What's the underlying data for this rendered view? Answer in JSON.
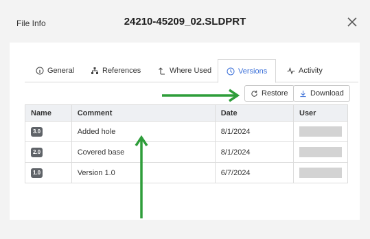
{
  "header": {
    "label": "File Info",
    "title": "24210-45209_02.SLDPRT"
  },
  "tabs": [
    {
      "label": "General",
      "icon": "info-icon"
    },
    {
      "label": "References",
      "icon": "hierarchy-icon"
    },
    {
      "label": "Where Used",
      "icon": "arrow-up-corner-icon"
    },
    {
      "label": "Versions",
      "icon": "clock-icon",
      "active": true
    },
    {
      "label": "Activity",
      "icon": "pulse-icon"
    }
  ],
  "actions": {
    "restore_label": "Restore",
    "download_label": "Download"
  },
  "table": {
    "headers": [
      "Name",
      "Comment",
      "Date",
      "User"
    ],
    "rows": [
      {
        "name": "3.0",
        "comment": "Added hole",
        "date": "8/1/2024"
      },
      {
        "name": "2.0",
        "comment": "Covered base",
        "date": "8/1/2024"
      },
      {
        "name": "1.0",
        "comment": "Version 1.0",
        "date": "6/7/2024"
      }
    ]
  },
  "colors": {
    "accent": "#3a6fd8",
    "annotation": "#2e9d3a",
    "badge": "#5f6368"
  }
}
